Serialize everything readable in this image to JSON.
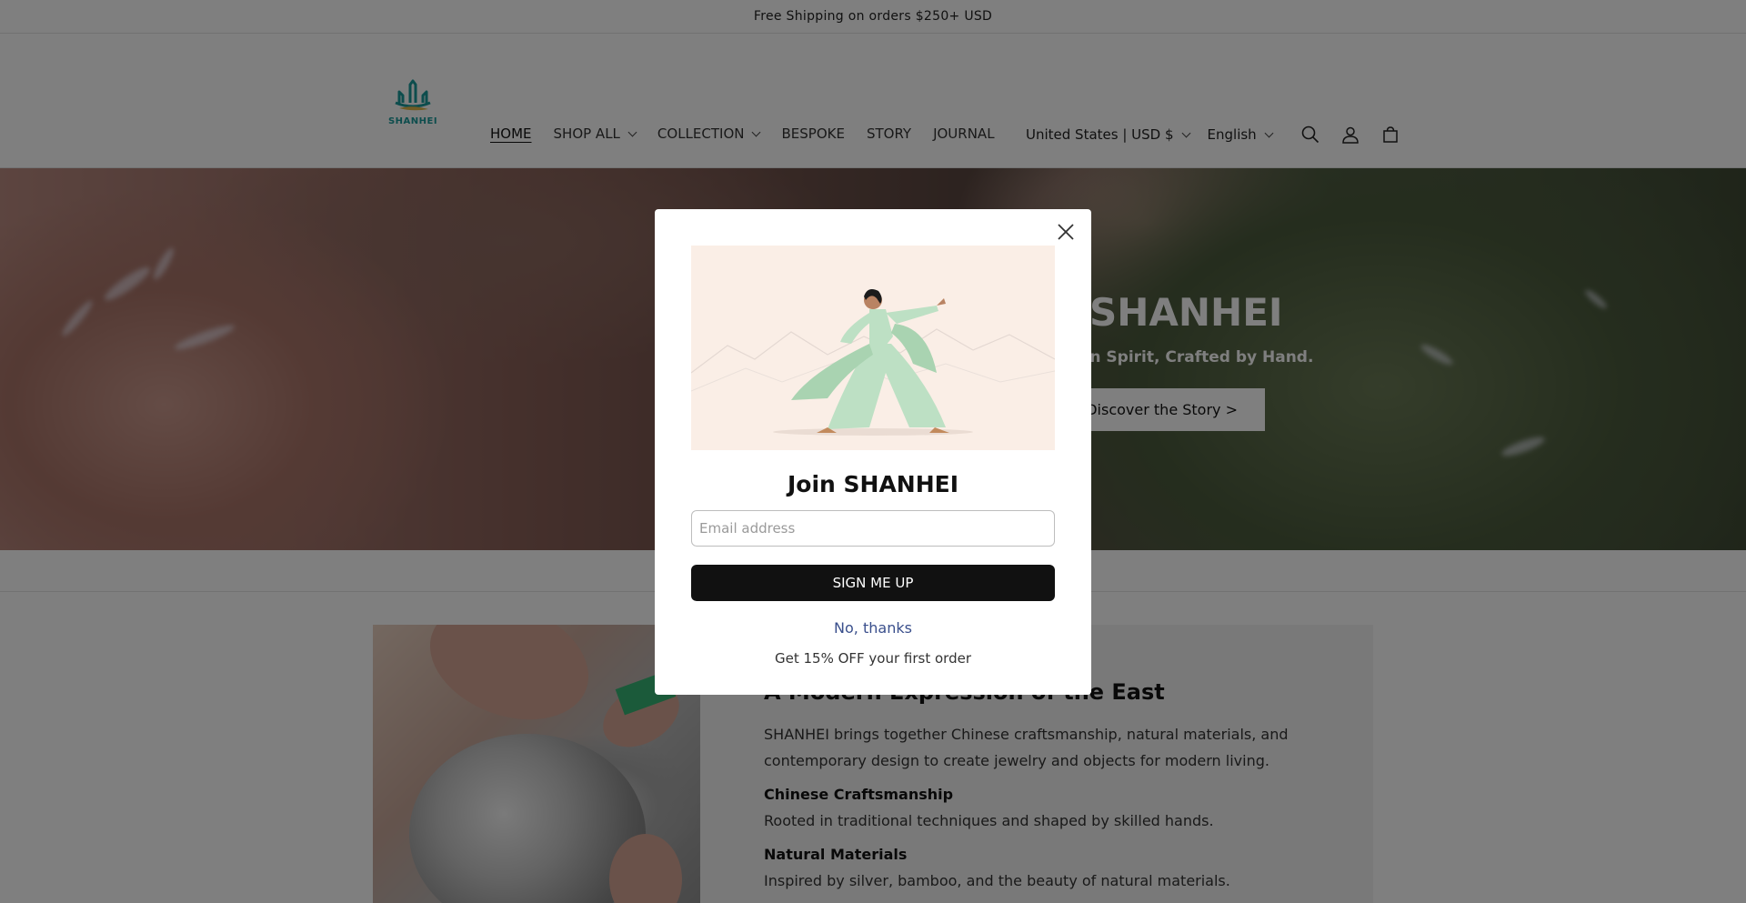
{
  "announcement": {
    "text": "Free Shipping on orders $250+ USD"
  },
  "logo": {
    "text": "SHANHEI"
  },
  "nav": {
    "items": [
      {
        "label": "HOME",
        "active": true,
        "has_dropdown": false
      },
      {
        "label": "SHOP ALL",
        "active": false,
        "has_dropdown": true
      },
      {
        "label": "COLLECTION",
        "active": false,
        "has_dropdown": true
      },
      {
        "label": "BESPOKE",
        "active": false,
        "has_dropdown": false
      },
      {
        "label": "STORY",
        "active": false,
        "has_dropdown": false
      },
      {
        "label": "JOURNAL",
        "active": false,
        "has_dropdown": false
      }
    ]
  },
  "header_right": {
    "country": "United States | USD $",
    "language": "English",
    "icons": [
      "search-icon",
      "account-icon",
      "cart-icon"
    ]
  },
  "hero": {
    "title": "SHANHEI",
    "subtitle": "rn Spirit, Crafted by Hand.",
    "button": "Discover the Story >"
  },
  "story": {
    "title": "A Modern Expression of the East",
    "intro": "SHANHEI brings together Chinese craftsmanship, natural materials, and contemporary design to create jewelry and objects for modern living.",
    "features": [
      {
        "heading": "Chinese Craftsmanship",
        "text": "Rooted in traditional techniques and shaped by skilled hands."
      },
      {
        "heading": "Natural Materials",
        "text": "Inspired by silver, bamboo, and the beauty of natural materials."
      }
    ]
  },
  "popup": {
    "title": "Join SHANHEI",
    "email_placeholder": "Email address",
    "email_value": "",
    "submit": "SIGN ME UP",
    "decline": "No, thanks",
    "note": "Get 15% OFF your first order"
  },
  "colors": {
    "accent_teal": "#1a9a9a",
    "logo_gold": "#e2b84a",
    "button_dark": "#111111",
    "link_blue": "#3a4f8c",
    "overlay": "rgba(0,0,0,0.5)"
  }
}
